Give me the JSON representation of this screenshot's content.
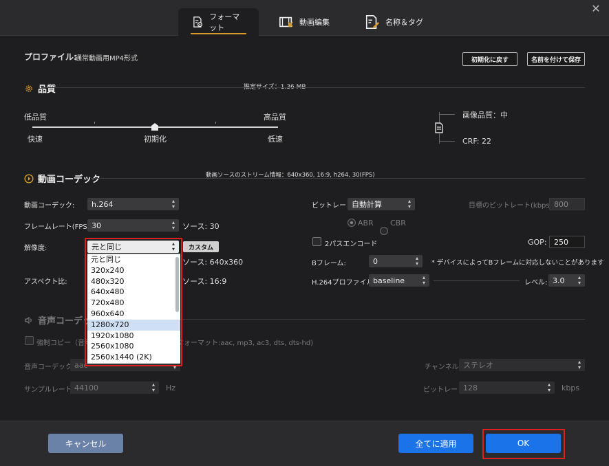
{
  "tabs": [
    {
      "label": "フォーマット",
      "icon": "format-settings-icon",
      "active": true
    },
    {
      "label": "動画編集",
      "icon": "video-edit-icon",
      "active": false
    },
    {
      "label": "名称＆タグ",
      "icon": "name-tag-icon",
      "active": false
    }
  ],
  "profile": {
    "label": "プロファイル:",
    "value": "通常動画用MP4形式",
    "reset_button": "初期化に戻す",
    "save_as_button": "名前を付けて保存"
  },
  "quality": {
    "title": "品質",
    "estimated_size": "推定サイズ：1.36 MB",
    "low_quality": "低品質",
    "high_quality": "高品質",
    "fast": "快速",
    "default": "初期化",
    "slow": "低速",
    "slider_level": 0.5,
    "image_quality": "画像品質：中",
    "crf": "CRF: 22"
  },
  "video_codec": {
    "title": "動画コーデック",
    "stream_info": "動画ソースのストリーム情報：640x360, 16:9, h264, 30(FPS)",
    "codec_label": "動画コーデック:",
    "codec_value": "h.264",
    "framerate_label": "フレームレート(FPS):",
    "framerate_value": "30",
    "framerate_source": "ソース: 30",
    "resolution_label": "解像度:",
    "resolution_value": "元と同じ",
    "custom_button": "カスタム",
    "resolution_source": "ソース: 640x360",
    "aspect_label": "アスペクト比:",
    "aspect_source": "ソース: 16:9",
    "bitrate_label": "ビットレート:",
    "bitrate_value": "自動計算",
    "target_bitrate_label": "目標のビットレート(kbps):",
    "target_bitrate_value": "800",
    "abr": "ABR",
    "cbr": "CBR",
    "two_pass": "2パスエンコード",
    "gop_label": "GOP:",
    "gop_value": "250",
    "bframe_label": "Bフレーム:",
    "bframe_value": "0",
    "bframe_note": "* デバイスによってBフレームに対応しないことがあります",
    "h264_profile_label": "H.264プロファイル:",
    "h264_profile_value": "baseline",
    "level_label": "レベル:",
    "level_value": "3.0"
  },
  "resolution_options": [
    "元と同じ",
    "320x240",
    "480x320",
    "640x480",
    "720x480",
    "960x640",
    "1280x720",
    "1920x1080",
    "2560x1080",
    "2560x1440 (2K)"
  ],
  "audio_codec": {
    "title": "音声コーデック",
    "force_copy": "強制コピー（音声",
    "formats": "フォーマット:aac, mp3, ac3, dts, dts-hd)",
    "codec_label": "音声コーデック:",
    "codec_value": "aac",
    "channel_label": "チャンネル:",
    "channel_value": "ステレオ",
    "samplerate_label": "サンプルレート:",
    "samplerate_value": "44100",
    "hz": "Hz",
    "bitrate_label": "ビットレート:",
    "bitrate_value": "128",
    "kbps": "kbps"
  },
  "footer": {
    "cancel": "キャンセル",
    "apply_all": "全てに適用",
    "ok": "OK"
  },
  "colors": {
    "accent_orange": "#d89a2b",
    "primary_blue": "#1a73e8",
    "cancel_gray_blue": "#6b82a8",
    "highlight_red": "#e01e1e"
  }
}
